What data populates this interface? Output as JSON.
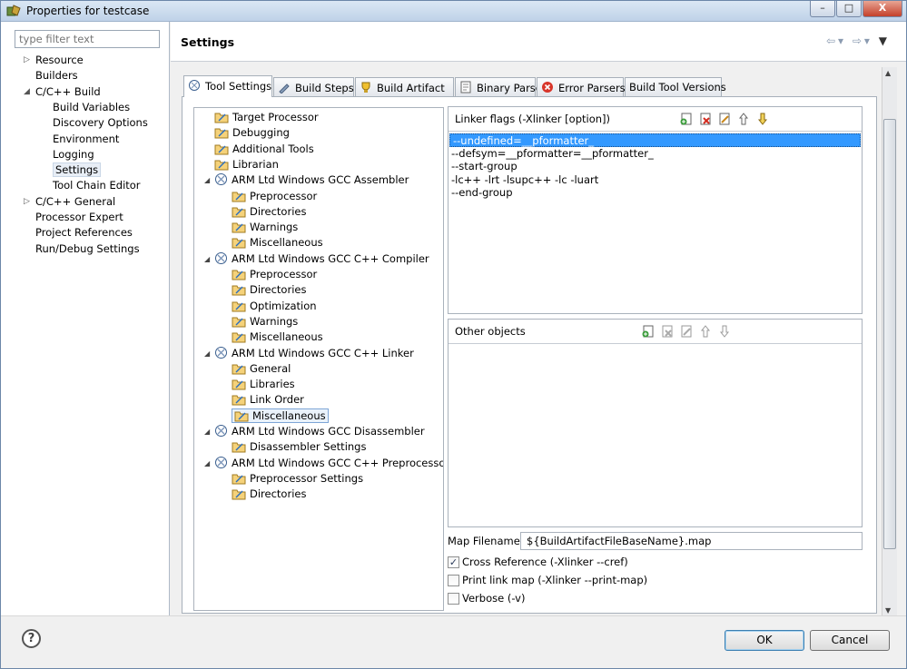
{
  "window": {
    "title": "Properties for testcase",
    "minimize": "–",
    "maximize": "□",
    "close": "X"
  },
  "filter": {
    "placeholder": "type filter text"
  },
  "nav": [
    {
      "label": "Resource",
      "twist": "▷"
    },
    {
      "label": "Builders",
      "twist": ""
    },
    {
      "label": "C/C++ Build",
      "twist": "◢"
    },
    {
      "label": "Build Variables",
      "twist": ""
    },
    {
      "label": "Discovery Options",
      "twist": ""
    },
    {
      "label": "Environment",
      "twist": ""
    },
    {
      "label": "Logging",
      "twist": ""
    },
    {
      "label": "Settings",
      "twist": ""
    },
    {
      "label": "Tool Chain Editor",
      "twist": ""
    },
    {
      "label": "C/C++ General",
      "twist": "▷"
    },
    {
      "label": "Processor Expert",
      "twist": ""
    },
    {
      "label": "Project References",
      "twist": ""
    },
    {
      "label": "Run/Debug Settings",
      "twist": ""
    }
  ],
  "header": {
    "title": "Settings"
  },
  "tabs": [
    "Tool Settings",
    "Build Steps",
    "Build Artifact",
    "Binary Parsers",
    "Error Parsers",
    "Build Tool Versions"
  ],
  "tree": [
    {
      "label": "Target Processor",
      "twist": ""
    },
    {
      "label": "Debugging",
      "twist": ""
    },
    {
      "label": "Additional Tools",
      "twist": ""
    },
    {
      "label": "Librarian",
      "twist": ""
    },
    {
      "label": "ARM Ltd Windows GCC Assembler",
      "twist": "◢"
    },
    {
      "label": "Preprocessor",
      "twist": ""
    },
    {
      "label": "Directories",
      "twist": ""
    },
    {
      "label": "Warnings",
      "twist": ""
    },
    {
      "label": "Miscellaneous",
      "twist": ""
    },
    {
      "label": "ARM Ltd Windows GCC C++ Compiler",
      "twist": "◢"
    },
    {
      "label": "Preprocessor",
      "twist": ""
    },
    {
      "label": "Directories",
      "twist": ""
    },
    {
      "label": "Optimization",
      "twist": ""
    },
    {
      "label": "Warnings",
      "twist": ""
    },
    {
      "label": "Miscellaneous",
      "twist": ""
    },
    {
      "label": "ARM Ltd Windows GCC C++ Linker",
      "twist": "◢"
    },
    {
      "label": "General",
      "twist": ""
    },
    {
      "label": "Libraries",
      "twist": ""
    },
    {
      "label": "Link Order",
      "twist": ""
    },
    {
      "label": "Miscellaneous",
      "twist": ""
    },
    {
      "label": "ARM Ltd Windows GCC Disassembler",
      "twist": "◢"
    },
    {
      "label": "Disassembler Settings",
      "twist": ""
    },
    {
      "label": "ARM Ltd Windows GCC C++ Preprocessor",
      "twist": "◢"
    },
    {
      "label": "Preprocessor Settings",
      "twist": ""
    },
    {
      "label": "Directories",
      "twist": ""
    }
  ],
  "linker_flags": {
    "label": "Linker flags (-Xlinker [option])",
    "items": [
      "--undefined=__pformatter_",
      "--defsym=__pformatter=__pformatter_",
      "--start-group",
      "-lc++ -lrt -lsupc++ -lc -luart",
      "--end-group"
    ]
  },
  "other_objects": {
    "label": "Other objects"
  },
  "map_filename": {
    "label": "Map Filename",
    "value": "${BuildArtifactFileBaseName}.map"
  },
  "checkboxes": [
    {
      "label": "Cross Reference (-Xlinker --cref)",
      "mark": "✓"
    },
    {
      "label": "Print link map (-Xlinker --print-map)",
      "mark": ""
    },
    {
      "label": "Verbose (-v)",
      "mark": ""
    }
  ],
  "footer": {
    "help": "?",
    "ok": "OK",
    "cancel": "Cancel"
  },
  "colors": {
    "selection": "#3399ff",
    "accent": "#3c7fb1"
  }
}
